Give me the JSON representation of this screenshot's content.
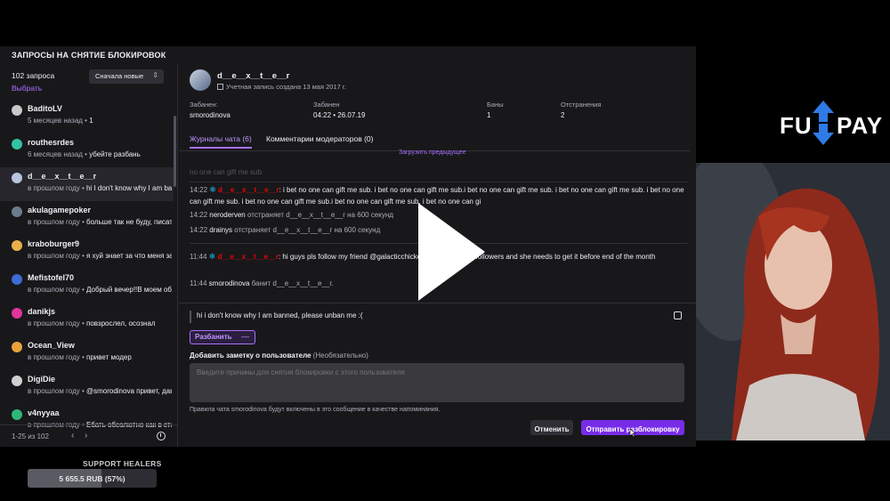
{
  "app": {
    "title": "ЗАПРОСЫ НА СНЯТИЕ БЛОКИРОВОК"
  },
  "list": {
    "count_label": "102 запроса",
    "select_label": "Выбрать",
    "sort_label": "Сначала новые",
    "items": [
      {
        "name": "BaditoLV",
        "time": "5 месяцев назад",
        "preview": "1",
        "avatar_color": "#c9c9c9"
      },
      {
        "name": "routhesrdes",
        "time": "6 месяцев назад",
        "preview": "убейте разбань",
        "avatar_color": "#34c3a3"
      },
      {
        "name": "d__e__x__t__e__r",
        "time": "в прошлом году",
        "preview": "hi I don't know why I am banned",
        "avatar_color": "#b8c4dc"
      },
      {
        "name": "akulagamepoker",
        "time": "в прошлом году",
        "preview": "больше так не буду, писать",
        "avatar_color": "#6b7c8e"
      },
      {
        "name": "kraboburger9",
        "time": "в прошлом году",
        "preview": "я хуй знает за что меня забанили",
        "avatar_color": "#e8b04a"
      },
      {
        "name": "Mefistofel70",
        "time": "в прошлом году",
        "preview": "Добрый вечер!!В моем обращении",
        "avatar_color": "#3c6cd4"
      },
      {
        "name": "danikjs",
        "time": "в прошлом году",
        "preview": "повзрослел, осознал",
        "avatar_color": "#e0359a"
      },
      {
        "name": "Ocean_View",
        "time": "в прошлом году",
        "preview": "привет модер",
        "avatar_color": "#e8a23c"
      },
      {
        "name": "DigiDie",
        "time": "в прошлом году",
        "preview": "@smorodinova привет, давай",
        "avatar_color": "#d0d0d0"
      },
      {
        "name": "v4nyyaa",
        "time": "в прошлом году",
        "preview": "Ебать обсолютно как в ста",
        "avatar_color": "#2fb67a"
      }
    ],
    "pagination": "1-25 из 102",
    "prev_icon": "‹",
    "next_icon": "›"
  },
  "detail": {
    "username": "d__e__x__t__e__r",
    "created": "Учетная запись создана 13 мая 2017 г.",
    "stats": [
      {
        "key": "Забанен:",
        "value": "smorodinova"
      },
      {
        "key": "Забанен",
        "value": "04:22 • 26.07.19"
      },
      {
        "key": "Баны",
        "value": "1"
      },
      {
        "key": "Отстранения",
        "value": "2"
      }
    ],
    "tabs": {
      "chat_logs": "Журналы чата (6)",
      "mod_comments": "Комментарии модераторов (0)"
    },
    "load_previous": "Загрузить предыдущее",
    "log": {
      "faded": "no one can gift me sub",
      "msg1_time": "14:22",
      "msg1_user": "d__e__x__t__e__r",
      "msg1_text": ": i bet no one can gift me sub. i bet no one can gift me sub.i bet no one can gift me sub. i bet no one can gift me sub. i bet no one can gift me sub. i bet no one can gift me sub.i bet no one can gift me sub. i bet no one can gi",
      "sys1_time": "14:22",
      "sys1_user": "neroderven",
      "sys1_text": "отстраняет d__e__x__t__e__r на 600 секунд",
      "sys2_time": "14:22",
      "sys2_user": "drainys",
      "sys2_text": "отстраняет d__e__x__t__e__r на 600 секунд",
      "msg2_time": "11:44",
      "msg2_user": "d__e__x__t__e__r",
      "msg2_text": ": hi guys pls follow my friend @galacticchicken she needs 200 followers and she needs to get it before end of the month",
      "sys3_time": "11:44",
      "sys3_user": "smorodinova",
      "sys3_text": "банит d__e__x__t__e__r."
    },
    "request_message": "hi i don't know why I am banned, please unban me :(",
    "unban_label": "Разбанить",
    "unban_extra": "—",
    "note_label": "Добавить заметку о пользователе",
    "note_optional": "(Необязательно)",
    "note_placeholder": "Введите причины для снятия блокировки с этого пользователя",
    "hint": "Правила чата smorodinova будут включены в это сообщение в качестве напоминания.",
    "cancel_label": "Отменить",
    "send_label": "Отправить разблокировку"
  },
  "brand": {
    "left": "FU",
    "right": "PAY"
  },
  "goal": {
    "title": "SUPPORT HEALERS",
    "amount": "5 655.5 RUB (57%)",
    "progress": 0.57
  },
  "colors": {
    "accent": "#a970ff",
    "accent_button": "#772ce8",
    "username_red": "#eb0400",
    "brand_blue": "#2f7be5"
  }
}
